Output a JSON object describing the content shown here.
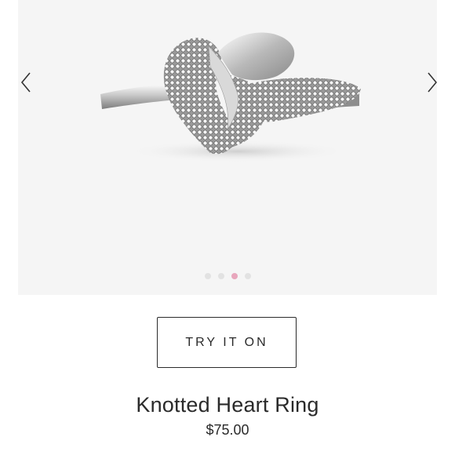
{
  "carousel": {
    "image_alt": "Knotted Heart Ring",
    "prev_icon": "chevron-left-icon",
    "next_icon": "chevron-right-icon",
    "slide_count": 4,
    "active_slide": 3,
    "dot_color": "#e2e2e2",
    "active_dot_color": "#e8a6bc",
    "background": "#f5f5f5"
  },
  "actions": {
    "try_on_label": "TRY IT ON"
  },
  "product": {
    "name": "Knotted Heart Ring",
    "price": "$75.00"
  }
}
